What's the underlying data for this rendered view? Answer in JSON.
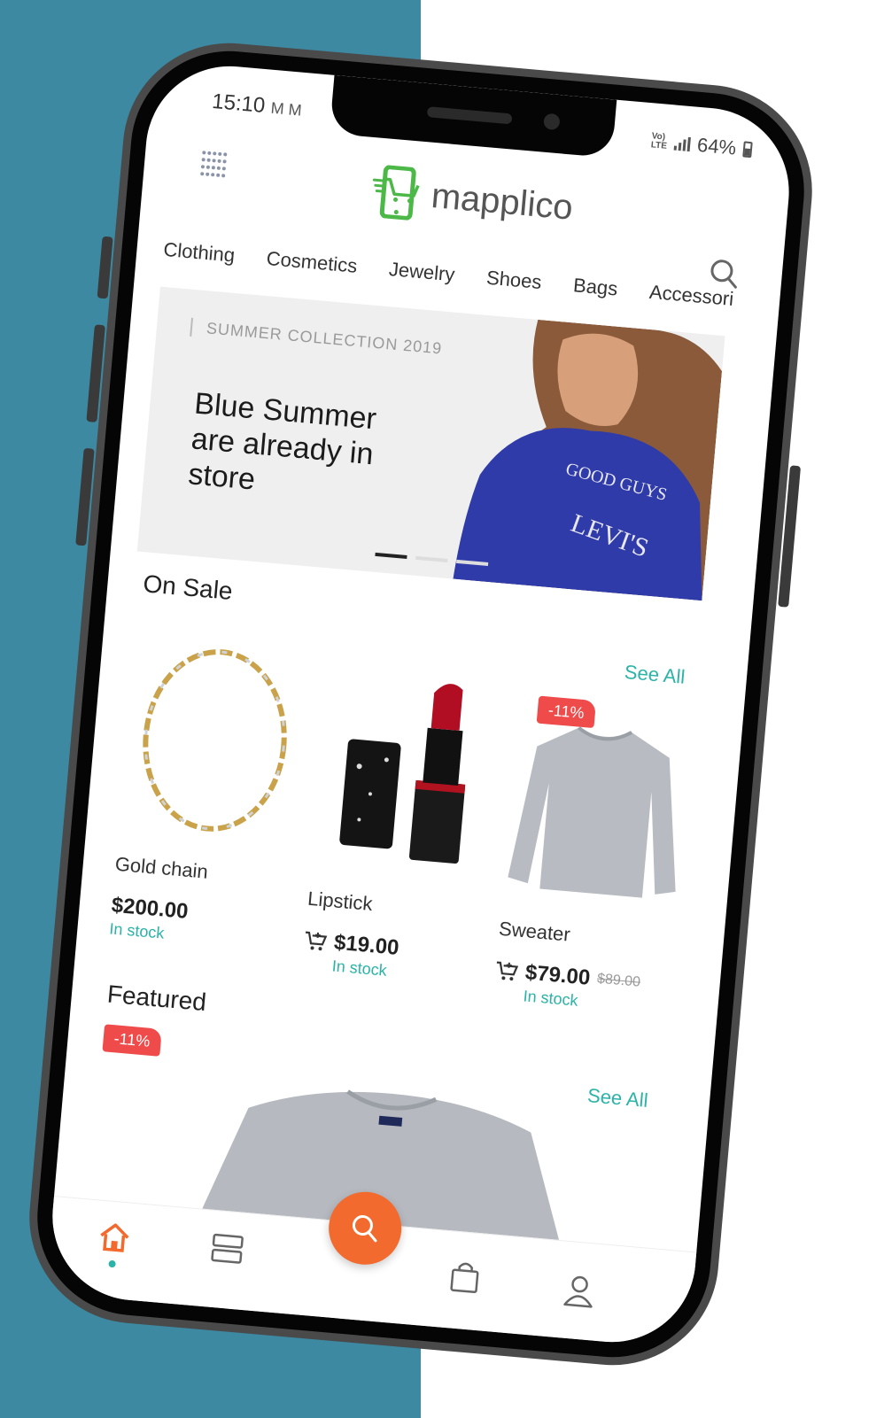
{
  "status": {
    "time": "15:10",
    "notif": "M M",
    "lte_line1": "Vo)",
    "lte_line2": "LTE",
    "battery": "64%"
  },
  "header": {
    "logo_text": "mapplico",
    "menu_icon": "grid-dots-icon",
    "search_icon": "search-icon"
  },
  "categories": [
    "Clothing",
    "Cosmetics",
    "Jewelry",
    "Shoes",
    "Bags",
    "Accessori"
  ],
  "banner": {
    "kicker": "SUMMER COLLECTION 2019",
    "title": "Blue Summer are already in store"
  },
  "on_sale": {
    "title": "On Sale",
    "see_all": "See All",
    "products": [
      {
        "name": "Gold chain",
        "price": "$200.00",
        "stock": "In stock"
      },
      {
        "name": "Lipstick",
        "price": "$19.00",
        "stock": "In stock"
      },
      {
        "name": "Sweater",
        "price": "$79.00",
        "old_price": "$89.00",
        "stock": "In stock",
        "badge": "-11%"
      }
    ]
  },
  "featured": {
    "title": "Featured",
    "see_all": "See All",
    "badge": "-11%"
  },
  "colors": {
    "accent": "#2bb3a8",
    "fab": "#f26a2d",
    "badge": "#ef4b4b",
    "home": "#f26a2d",
    "background_left": "#3d89a2"
  }
}
